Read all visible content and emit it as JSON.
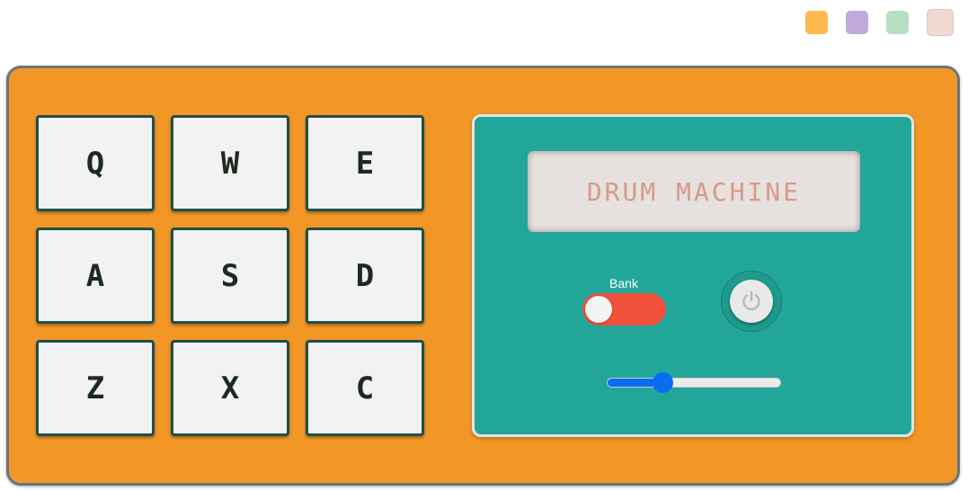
{
  "themes": [
    {
      "name": "orange",
      "color": "#ffb84d"
    },
    {
      "name": "purple",
      "color": "#c0a9dc"
    },
    {
      "name": "green",
      "color": "#b5dfc0"
    },
    {
      "name": "peach",
      "color": "#f1d8d0"
    }
  ],
  "pads": [
    "Q",
    "W",
    "E",
    "A",
    "S",
    "D",
    "Z",
    "X",
    "C"
  ],
  "display": {
    "text": "DRUM MACHINE"
  },
  "bank": {
    "label": "Bank",
    "on": false
  },
  "power": {
    "icon": "power-icon",
    "on": true
  },
  "volume": {
    "level": 0.32
  },
  "colors": {
    "body": "#f29726",
    "panel": "#22a699",
    "toggle": "#f0503a",
    "slider": "#0a6cf0"
  }
}
